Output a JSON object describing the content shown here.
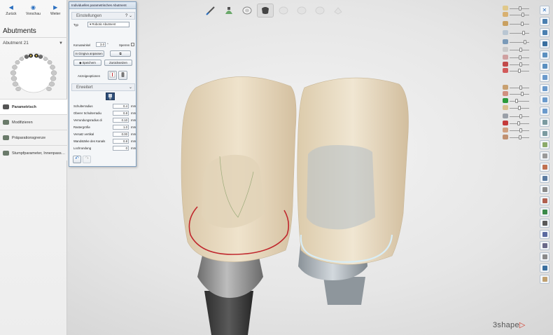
{
  "nav": {
    "back_label": "Zurück",
    "preview_label": "Vorschau",
    "next_label": "Weiter"
  },
  "section_title": "Abutments",
  "tooth_selector": "Abutment 21",
  "steps": [
    {
      "label": "Parametrisch",
      "active": true
    },
    {
      "label": "Modifizieren",
      "active": false
    },
    {
      "label": "Präparationsgrenze",
      "active": false
    },
    {
      "label": "Stumpfparameter, Innenpass…",
      "active": false
    }
  ],
  "tool_panel": {
    "title": "Individuelles parametrisches Abutment",
    "settings_header": "Einstellungen",
    "settings_header_right": "? ⌄",
    "type_label": "Typ",
    "type_value": "Robotic Abutment",
    "cone_angle_label": "Konuswinkel",
    "cone_angle_value": "3.0",
    "cone_angle_unit": "°",
    "lock_label": "Sperren",
    "fit_gingiva_label": "In Gingiva anpassen",
    "save_label": "Speichern",
    "reset_label": "Zurücksetzen",
    "display_options_label": "Anzeigeoptionen",
    "advanced_header": "Erweitert",
    "advanced_header_right": "⌄",
    "params": [
      {
        "label": "Schulterradius",
        "value": "0.4",
        "unit": "mm"
      },
      {
        "label": "Oberer Schulterradiu",
        "value": "0.8",
        "unit": "mm"
      },
      {
        "label": "Verrundungsradius di",
        "value": "0.10",
        "unit": "mm"
      },
      {
        "label": "Rastergröße",
        "value": "1.0",
        "unit": "mm"
      },
      {
        "label": "Versatz vertikal",
        "value": "0.00",
        "unit": "mm"
      },
      {
        "label": "Wandstärke des Kanals",
        "value": "0.8",
        "unit": "mm"
      },
      {
        "label": "Lochrundung",
        "value": "0",
        "unit": "mm"
      }
    ]
  },
  "view_toolbar": [
    "brush-tool-icon",
    "sculpt-tool-icon",
    "tooth-view-icon",
    "abutment-view-icon",
    "tooth-dim-icon-1",
    "tooth-dim-icon-2",
    "tooth-dim-icon-3",
    "tooth-dim-icon-4"
  ],
  "visibility_sliders": [
    {
      "color": "#e0c88a",
      "level": 0.55
    },
    {
      "color": "#d8b070",
      "level": 0.7
    },
    {
      "color": "#c9a060",
      "level": 0.65
    },
    {
      "color": "#b9c6d2",
      "level": 0.75
    },
    {
      "color": "#7a9ab8",
      "level": 0.85
    },
    {
      "color": "#c9c9c9",
      "level": 0.6
    },
    {
      "color": "#cfa0a0",
      "level": 0.55
    },
    {
      "color": "#c24a4a",
      "level": 0.6
    },
    {
      "color": "#d25a5a",
      "level": 0.5
    },
    {
      "color": "#c8a070",
      "level": 0.6
    },
    {
      "color": "#d09080",
      "level": 0.65
    },
    {
      "color": "#2a9a3a",
      "level": 0.35
    },
    {
      "color": "#d8c090",
      "level": 0.5
    },
    {
      "color": "#9aa0a8",
      "level": 0.6
    },
    {
      "color": "#c43a3a",
      "level": 0.45
    },
    {
      "color": "#d0a080",
      "level": 0.6
    },
    {
      "color": "#c09070",
      "level": 0.55
    }
  ],
  "right_toolbar": [
    "close-icon",
    "expand-icon",
    "layers-icon",
    "screenshot-icon",
    "view-front-icon",
    "view-back-icon",
    "view-top-icon",
    "view-bottom-icon",
    "view-left-icon",
    "view-right-icon",
    "zoom-icon",
    "measure-icon",
    "section-icon",
    "transparency-icon",
    "tooth-icon",
    "grid-icon",
    "lock-icon",
    "face-icon",
    "warning-icon",
    "camera-icon",
    "paint-icon",
    "implant-icon",
    "settings-icon",
    "export-icon",
    "help-icon"
  ],
  "logo_text": "3shape",
  "logo_mark": "▷"
}
